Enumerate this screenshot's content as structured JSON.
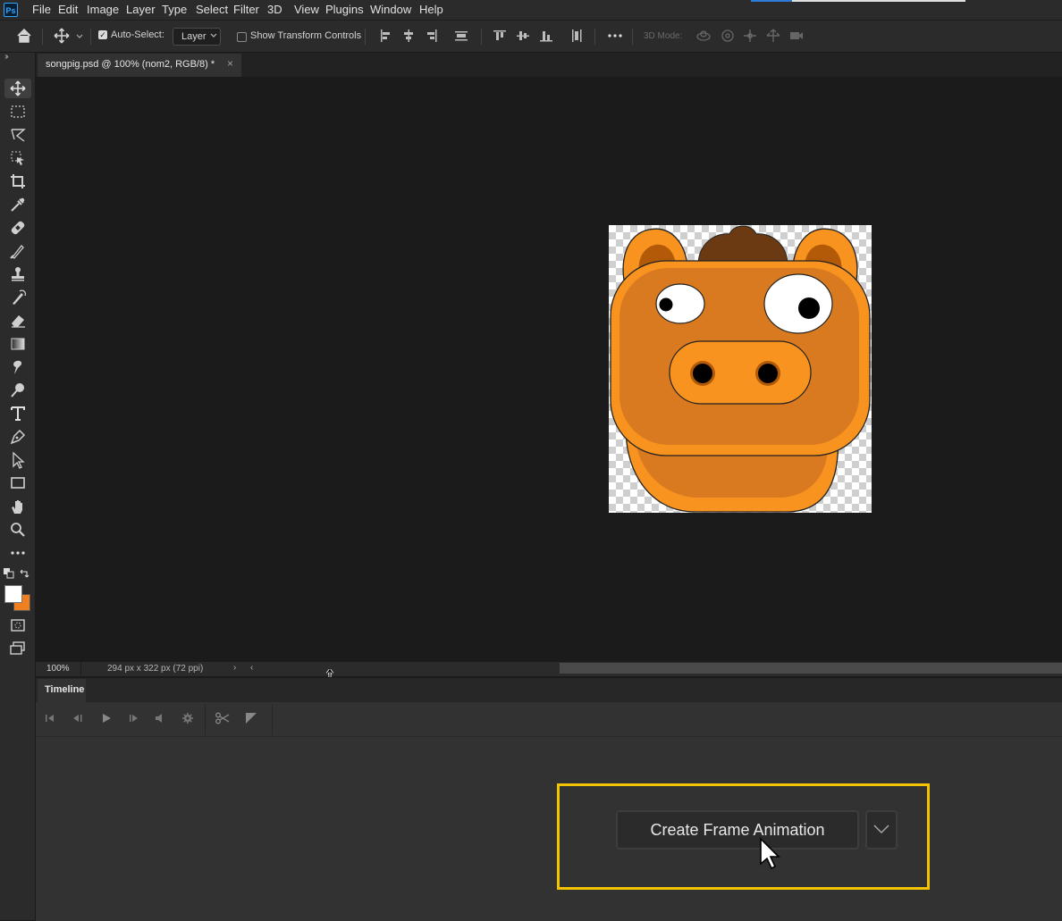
{
  "app": {
    "logo": "Ps"
  },
  "menu": [
    "File",
    "Edit",
    "Image",
    "Layer",
    "Type",
    "Select",
    "Filter",
    "3D",
    "View",
    "Plugins",
    "Window",
    "Help"
  ],
  "options_bar": {
    "auto_select_label": "Auto-Select:",
    "auto_select_checked": true,
    "layer_select_value": "Layer",
    "show_transform_label": "Show Transform Controls",
    "show_transform_checked": false,
    "mode_3d_label": "3D Mode:"
  },
  "document_tab": {
    "title": "songpig.psd @ 100% (nom2, RGB/8) *",
    "close": "×"
  },
  "status_bar": {
    "zoom": "100%",
    "doc_info": "294 px x 322 px (72 ppi)",
    "arrow": "›",
    "scroll_left": "‹"
  },
  "timeline": {
    "title": "Timeline",
    "create_button_label": "Create Frame Animation"
  },
  "colors": {
    "foreground": "#ffffff",
    "background": "#f07f1f",
    "highlight": "#f5c400",
    "pig_orange": "#f7931e",
    "pig_dark": "#d97a20"
  },
  "icons": [
    "home-icon",
    "move-icon",
    "marquee-icon",
    "lasso-icon",
    "object-select-icon",
    "crop-icon",
    "eyedropper-icon",
    "healing-icon",
    "brush-icon",
    "stamp-icon",
    "history-brush-icon",
    "eraser-icon",
    "gradient-icon",
    "smudge-icon",
    "dodge-icon",
    "type-icon",
    "pen-icon",
    "path-select-icon",
    "rectangle-icon",
    "hand-icon",
    "zoom-icon",
    "more-icon",
    "quick-mask-icon",
    "screen-mode-icon"
  ]
}
